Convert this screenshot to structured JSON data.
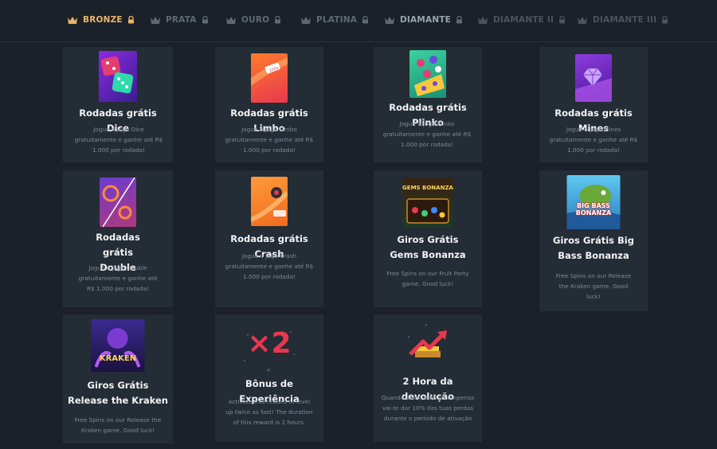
{
  "tabs": [
    {
      "label": "BRONZE",
      "active": true
    },
    {
      "label": "PRATA",
      "active": false
    },
    {
      "label": "OURO",
      "active": false
    },
    {
      "label": "PLATINA",
      "active": false
    },
    {
      "label": "DIAMANTE",
      "active": false
    },
    {
      "label": "DIAMANTE II",
      "active": false
    },
    {
      "label": "DIAMANTE III",
      "active": false
    }
  ],
  "rewards": [
    {
      "title": "Rodadas grátis Dice",
      "description": "Jogue o jogo Dice gratuitamente e ganhe até R$ 1.000 por rodada!",
      "image": "dice-game-image"
    },
    {
      "title": "Rodadas grátis Limbo",
      "description": "Jogue o jogo Limbo gratuitamente e ganhe até R$ 1.000 por rodada!",
      "image": "limbo-game-image"
    },
    {
      "title": "Rodadas grátis Plinko",
      "description": "Jogue o jogo Plinko gratuitamente e ganhe até R$ 1.000 por rodada!",
      "image": "plinko-game-image"
    },
    {
      "title": "Rodadas grátis Mines",
      "description": "Jogue o jogo Mines gratuitamente e ganhe até R$ 1.000 por rodada!",
      "image": "mines-game-image"
    },
    {
      "title": "Rodadas grátis Double",
      "description": "Jogue o jogo Double gratuitamente e ganhe até R$ 1.000 por rodada!",
      "image": "double-game-image"
    },
    {
      "title": "Rodadas grátis Crash",
      "description": "Jogue o jogo Crash gratuitamente e ganhe até R$ 1.000 por rodada!",
      "image": "crash-game-image"
    },
    {
      "title": "Giros Grátis Gems Bonanza",
      "description": "Free Spins on our Fruit Party game. Good luck!",
      "image": "gems-bonanza-image",
      "image_text": "GEMS BONANZA"
    },
    {
      "title": "Giros Grátis Big Bass Bonanza",
      "description": "Free Spins on our Release the Kraken game. Good luck!",
      "image": "big-bass-bonanza-image",
      "image_text": "BIG BASS BONANZA"
    },
    {
      "title": "Giros Grátis Release the Kraken",
      "description": "Free Spins on our Release the Kraken game. Good luck!",
      "image": "release-the-kraken-image",
      "image_text": "KRAKEN"
    },
    {
      "title": "Bônus de Experiência",
      "description": "Activate this reward to level up twice as fast! The duration of this reward is 2 hours.",
      "image": "x2-multiplier-icon",
      "image_text": "×2"
    },
    {
      "title": "2 Hora da devolução",
      "description": "Quando ativo, esta recompensa vai-te dar 10% das tuas perdas durante o período de ativação",
      "image": "cashback-chart-icon"
    }
  ],
  "colors": {
    "background": "#1b2129",
    "card": "#242c35",
    "active_tab": "#e9b56a",
    "inactive_tab": "#5e6975",
    "accent_red": "#e8384f"
  }
}
